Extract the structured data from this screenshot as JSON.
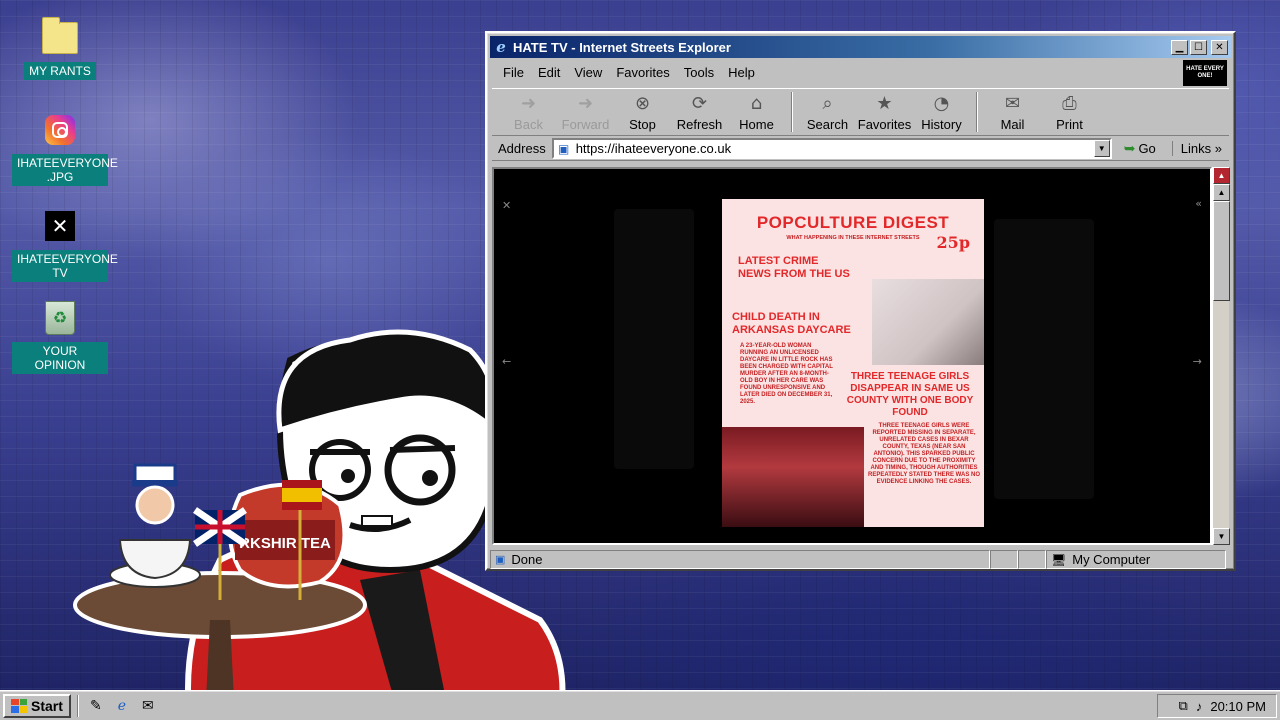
{
  "desktop": {
    "icons": [
      {
        "label": "MY RANTS",
        "icon": "folder-icon"
      },
      {
        "label": "IHATEEVERYONE .JPG",
        "icon": "instagram-icon"
      },
      {
        "label": "IHATEEVERYONE TV",
        "icon": "x-icon"
      },
      {
        "label": "YOUR OPINION",
        "icon": "recycle-bin-icon"
      }
    ]
  },
  "illustration": {
    "tea_brand": "RKSHIR TEA"
  },
  "window": {
    "title": "HATE TV - Internet Streets Explorer",
    "brand_badge": "HATE EVERY ONE!",
    "menu": [
      "File",
      "Edit",
      "View",
      "Favorites",
      "Tools",
      "Help"
    ],
    "toolbar": {
      "back": "Back",
      "forward": "Forward",
      "stop": "Stop",
      "refresh": "Refresh",
      "home": "Home",
      "search": "Search",
      "favorites": "Favorites",
      "history": "History",
      "mail": "Mail",
      "print": "Print"
    },
    "address": {
      "label": "Address",
      "url": "https://ihateeveryone.co.uk",
      "go": "Go",
      "links": "Links"
    },
    "status": {
      "text": "Done",
      "zone": "My Computer"
    }
  },
  "magazine": {
    "title": "POPCULTURE DIGEST",
    "subtitle": "WHAT HAPPENING IN THESE INTERNET STREETS",
    "price": "25p",
    "headline1": "LATEST CRIME NEWS FROM THE US",
    "headline2": "CHILD DEATH IN ARKANSAS DAYCARE",
    "body1": "A 23-YEAR-OLD WOMAN RUNNING AN UNLICENSED DAYCARE IN LITTLE ROCK HAS BEEN CHARGED WITH CAPITAL MURDER AFTER AN 8-MONTH-OLD BOY IN HER CARE WAS FOUND UNRESPONSIVE AND LATER DIED ON DECEMBER 31, 2025.",
    "headline3": "THREE TEENAGE GIRLS DISAPPEAR IN SAME US COUNTY WITH ONE BODY FOUND",
    "body2": "THREE TEENAGE GIRLS WERE REPORTED MISSING IN SEPARATE, UNRELATED CASES IN BEXAR COUNTY, TEXAS (NEAR SAN ANTONIO). THIS SPARKED PUBLIC CONCERN DUE TO THE PROXIMITY AND TIMING, THOUGH AUTHORITIES REPEATEDLY STATED THERE WAS NO EVIDENCE LINKING THE CASES."
  },
  "taskbar": {
    "start": "Start",
    "clock": "20:10 PM"
  },
  "colors": {
    "title_gradient_start": "#0a246a",
    "magazine_red": "#e2282a",
    "desktop_label_bg": "#0b7f7b"
  }
}
